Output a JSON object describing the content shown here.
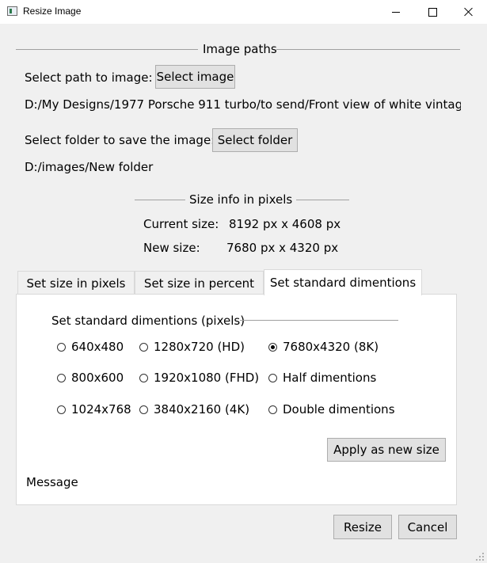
{
  "window": {
    "title": "Resize Image",
    "icon": "app-icon"
  },
  "image_paths": {
    "section_title": "Image paths",
    "select_path_label": "Select path to image:",
    "select_image_button": "Select image",
    "image_path": "D:/My Designs/1977 Porsche 911 turbo/to send/Front view of white vintag",
    "select_folder_label": "Select folder to save the image:",
    "select_folder_button": "Select folder",
    "folder_path": "D:/images/New folder"
  },
  "size_info": {
    "section_title": "Size info in pixels",
    "current_label": "Current size:",
    "current_value": "8192 px x 4608 px",
    "new_label": "New size:",
    "new_value": "7680 px x 4320 px"
  },
  "tabs": [
    {
      "label": "Set size in pixels",
      "active": false
    },
    {
      "label": "Set size in percent",
      "active": false
    },
    {
      "label": "Set standard dimentions",
      "active": true
    }
  ],
  "standard": {
    "group_title": "Set standard dimentions (pixels)",
    "options": [
      {
        "label": "640x480",
        "checked": false
      },
      {
        "label": "1280x720 (HD)",
        "checked": false
      },
      {
        "label": "7680x4320 (8K)",
        "checked": true
      },
      {
        "label": "800x600",
        "checked": false
      },
      {
        "label": "1920x1080 (FHD)",
        "checked": false
      },
      {
        "label": "Half dimentions",
        "checked": false
      },
      {
        "label": "1024x768",
        "checked": false
      },
      {
        "label": "3840x2160 (4K)",
        "checked": false
      },
      {
        "label": "Double dimentions",
        "checked": false
      }
    ],
    "apply_button": "Apply as new size"
  },
  "message": "Message",
  "footer": {
    "resize_button": "Resize",
    "cancel_button": "Cancel"
  }
}
